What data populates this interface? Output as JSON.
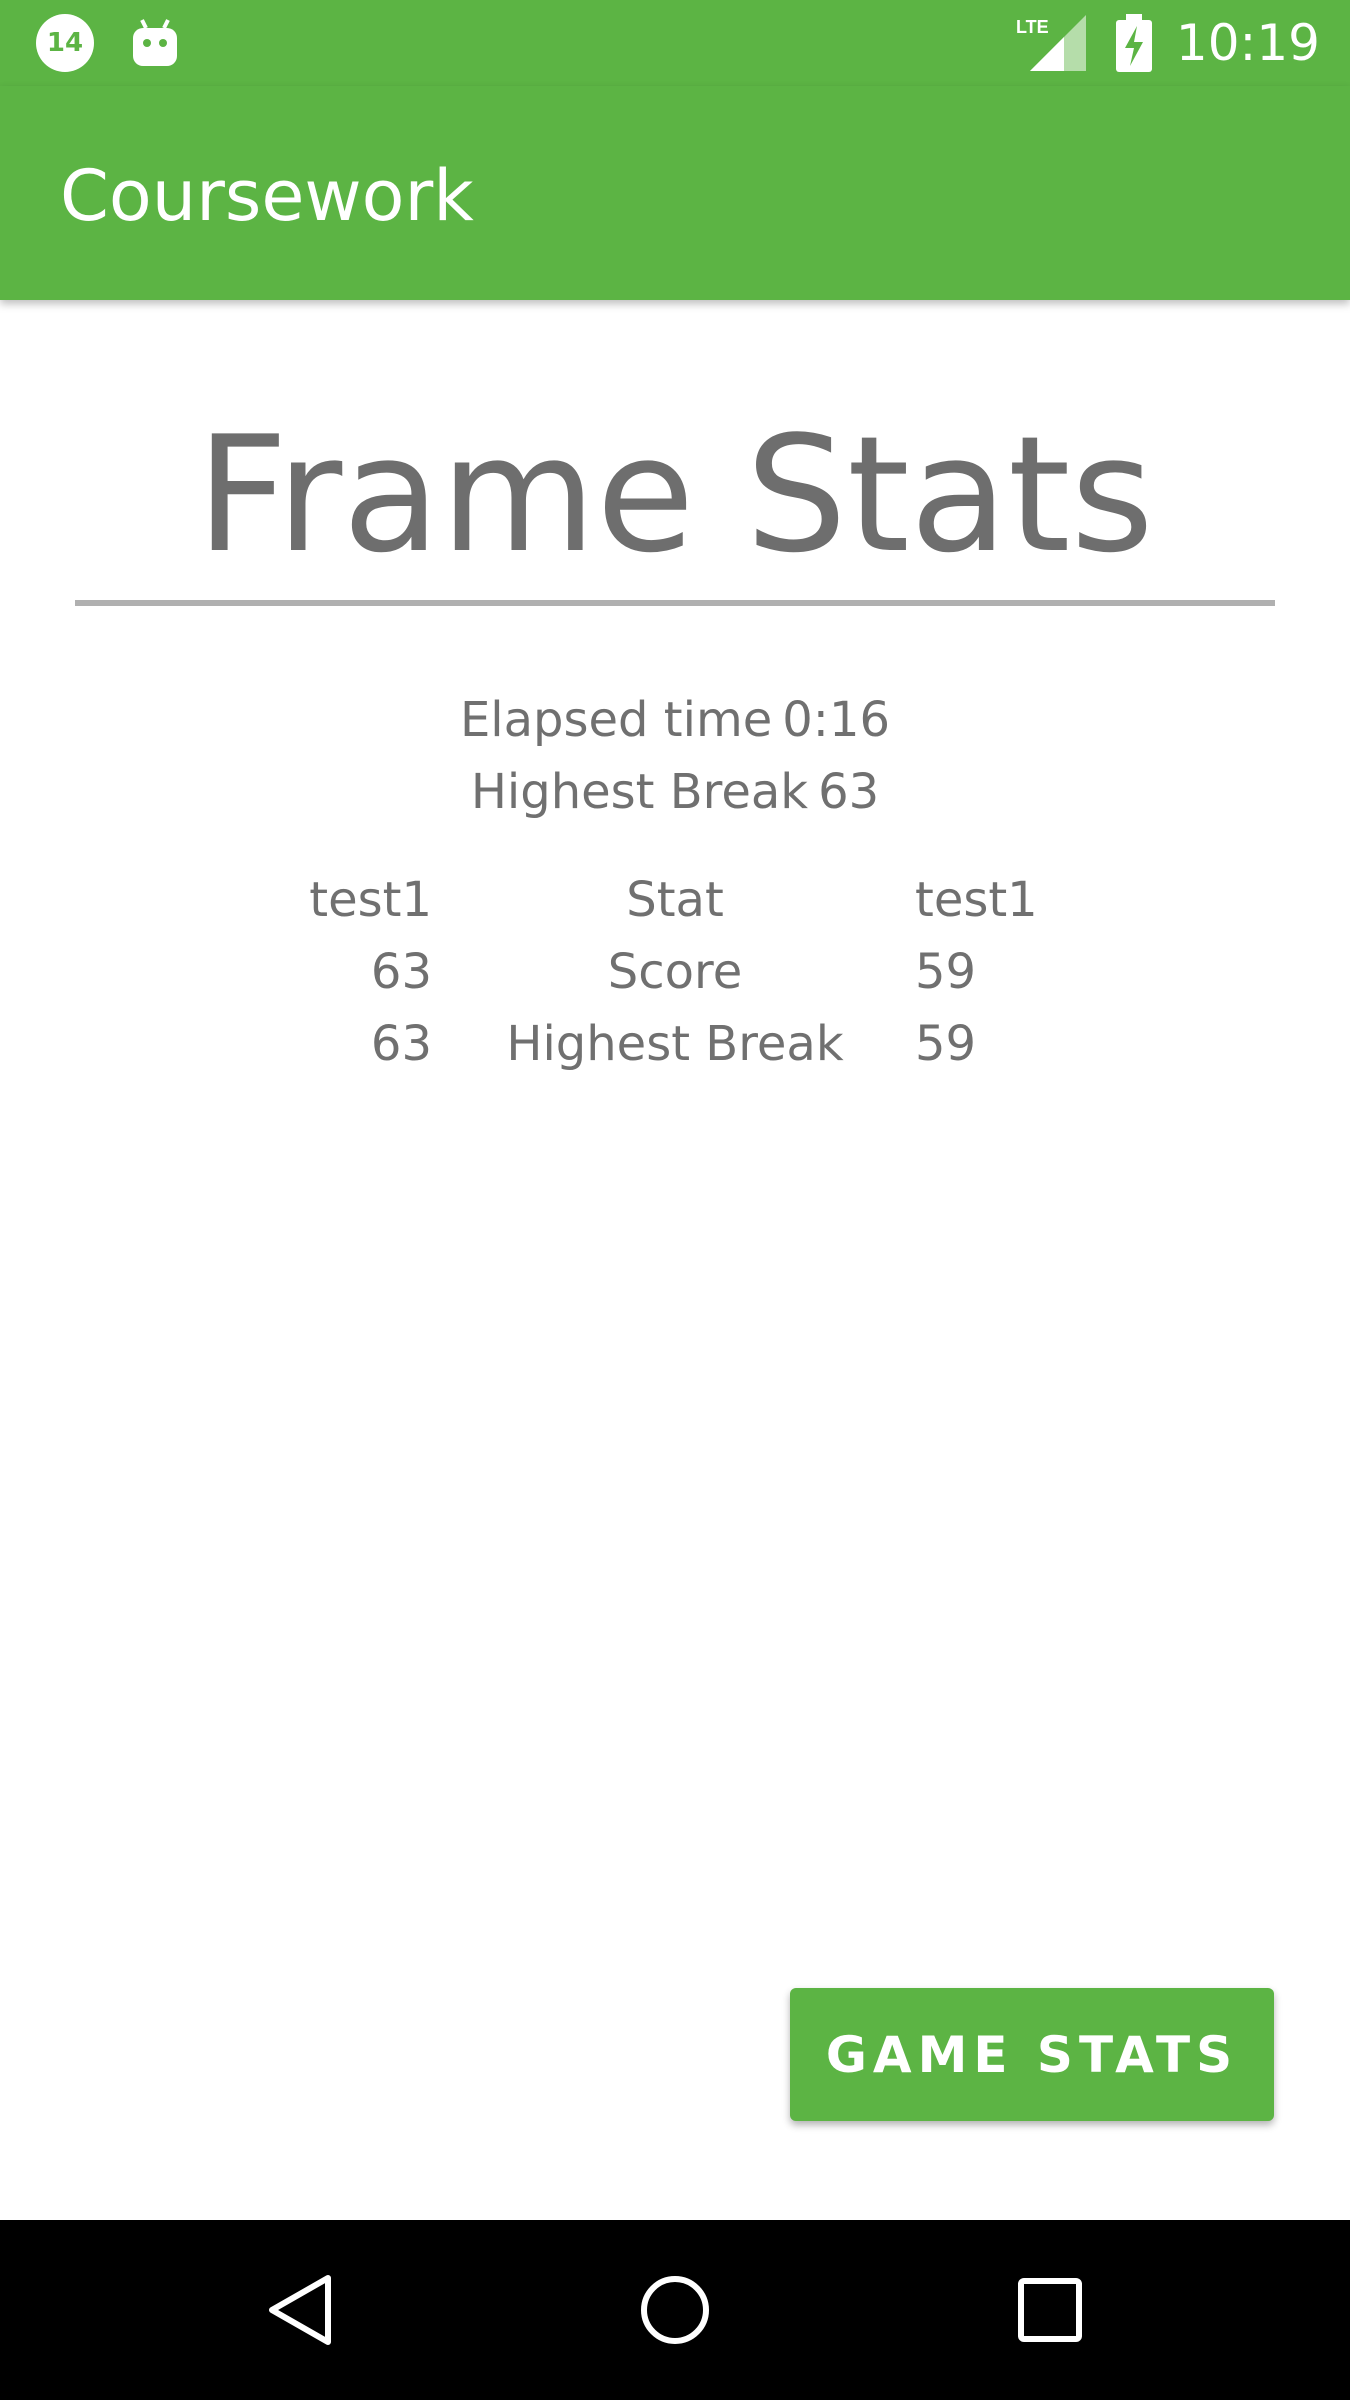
{
  "status_bar": {
    "notification_badge": "14",
    "time": "10:19",
    "network": "LTE",
    "icons": [
      "notification-badge-icon",
      "android-icon",
      "lte-signal-icon",
      "battery-charging-icon"
    ]
  },
  "app_bar": {
    "title": "Coursework"
  },
  "main": {
    "heading": "Frame Stats",
    "summary": {
      "elapsed_label": "Elapsed time",
      "elapsed_value": "0:16",
      "highest_break_label": "Highest Break",
      "highest_break_value": "63"
    },
    "table": {
      "header": {
        "left": "test1",
        "mid": "Stat",
        "right": "test1"
      },
      "rows": [
        {
          "left": "63",
          "mid": "Score",
          "right": "59"
        },
        {
          "left": "63",
          "mid": "Highest Break",
          "right": "59"
        }
      ]
    },
    "action_button": {
      "label": "GAME STATS"
    }
  },
  "nav_bar": {
    "icons": [
      "back-icon",
      "home-icon",
      "recents-icon"
    ]
  },
  "colors": {
    "accent": "#5cb444",
    "text": "#707070",
    "nav": "#000000"
  }
}
